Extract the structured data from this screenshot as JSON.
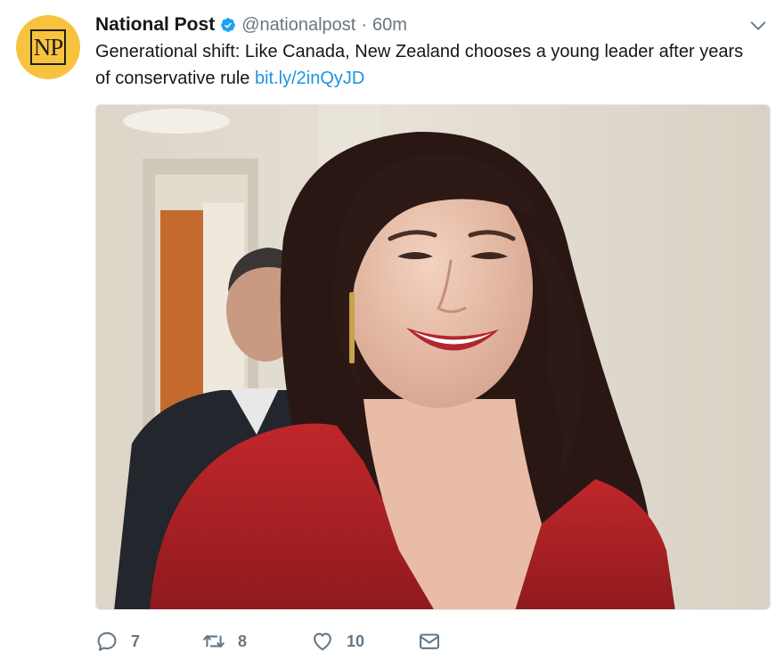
{
  "account": {
    "name": "National Post",
    "handle": "@nationalpost",
    "separator": "·",
    "time": "60m",
    "avatar_text": "NP",
    "avatar_color": "#f7c33f"
  },
  "tweet": {
    "text": "Generational shift: Like Canada, New Zealand chooses a young leader after years of conservative rule ",
    "link": "bit.ly/2inQyJD"
  },
  "actions": {
    "reply_count": "7",
    "retweet_count": "8",
    "like_count": "10"
  },
  "icons": {
    "verified": "verified-badge-icon",
    "menu": "chevron-down-icon",
    "reply": "reply-icon",
    "retweet": "retweet-icon",
    "like": "heart-icon",
    "message": "envelope-icon"
  },
  "colors": {
    "link": "#1b95e0",
    "verified": "#1da1f2",
    "muted": "#657786"
  }
}
